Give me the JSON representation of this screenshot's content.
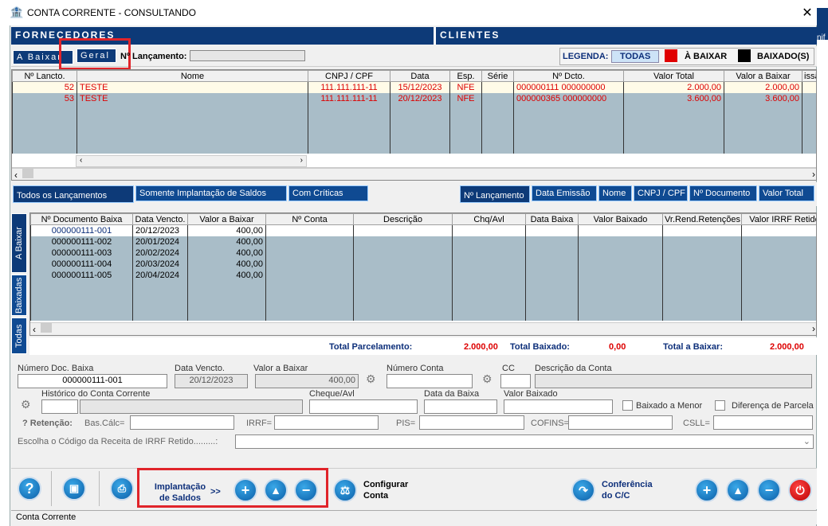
{
  "window": {
    "title": "CONTA CORRENTE  -  CONSULTANDO",
    "close": "✕",
    "right_text": "nif"
  },
  "tabs": {
    "fornecedores": "FORNECEDORES",
    "clientes": "CLIENTES"
  },
  "toolbar": {
    "a_baixar": "A Baixar",
    "geral": "Geral",
    "n_lancamento": "Nº Lançamento:",
    "legenda": "LEGENDA:",
    "todas": "TODAS",
    "a_baixar_leg": "À BAIXAR",
    "baixados": "BAIXADO(S)",
    "red": "#e00000",
    "black": "#000000"
  },
  "grid1": {
    "headers": [
      "Nº Lancto.",
      "Nome",
      "CNPJ / CPF",
      "Data",
      "Esp.",
      "Série",
      "Nº Dcto.",
      "Valor Total",
      "Valor a Baixar",
      "issão"
    ],
    "rows": [
      [
        "52",
        "TESTE",
        "111.111.111-11",
        "15/12/2023",
        "NFE",
        "",
        "000000111     000000000",
        "2.000,00",
        "2.000,00"
      ],
      [
        "53",
        "TESTE",
        "111.111.111-11",
        "20/12/2023",
        "NFE",
        "",
        "000000365     000000000",
        "3.600,00",
        "3.600,00"
      ]
    ]
  },
  "filters": {
    "todos": "Todos os Lançamentos",
    "somente": "Somente Implantação de Saldos",
    "com_criticas": "Com Críticas"
  },
  "sort": {
    "lancamento": "Nº Lançamento",
    "data_emissao": "Data Emissão",
    "nome": "Nome",
    "cnpj": "CNPJ / CPF",
    "documento": "Nº Documento",
    "valor_total": "Valor Total"
  },
  "vtabs": {
    "a_baixar": "A Baixar",
    "baixadas": "Baixadas",
    "todas": "Todas"
  },
  "grid2": {
    "headers": [
      "Nº Documento Baixa",
      "Data Vencto.",
      "Valor a Baixar",
      "Nº Conta",
      "Descrição",
      "Chq/Avl",
      "Data Baixa",
      "Valor Baixado",
      "Vr.Rend.Retenções",
      "Valor IRRF Retido"
    ],
    "rows": [
      [
        "000000111-001",
        "20/12/2023",
        "400,00"
      ],
      [
        "000000111-002",
        "20/01/2024",
        "400,00"
      ],
      [
        "000000111-003",
        "20/02/2024",
        "400,00"
      ],
      [
        "000000111-004",
        "20/03/2024",
        "400,00"
      ],
      [
        "000000111-005",
        "20/04/2024",
        "400,00"
      ]
    ]
  },
  "totals": {
    "parcelamento_label": "Total Parcelamento:",
    "parcelamento": "2.000,00",
    "baixado_label": "Total Baixado:",
    "baixado": "0,00",
    "a_baixar_label": "Total a Baixar:",
    "a_baixar": "2.000,00"
  },
  "form": {
    "numero_doc_label": "Número Doc. Baixa",
    "numero_doc": "000000111-001",
    "data_vencto_label": "Data Vencto.",
    "data_vencto": "20/12/2023",
    "valor_baixar_label": "Valor a Baixar",
    "valor_baixar": "400,00",
    "numero_conta_label": "Número Conta",
    "cc_label": "CC",
    "descricao_conta_label": "Descrição da Conta",
    "historico_label": "Histórico do Conta Corrente",
    "cheque_label": "Cheque/Avl",
    "data_baixa_label": "Data da Baixa",
    "valor_baixado_label": "Valor Baixado",
    "baixado_menor": "Baixado a Menor",
    "diferenca": "Diferença de Parcela",
    "retencao": "? Retenção:",
    "bas_calc": "Bas.Cálc=",
    "irrf": "IRRF=",
    "pis": "PIS=",
    "cofins": "COFINS=",
    "csll": "CSLL=",
    "escolha": "Escolha o Código da Receita de IRRF Retido.........:"
  },
  "bottom": {
    "implantacao": "Implantação de Saldos",
    "arrows": ">>",
    "configurar": "Configurar Conta",
    "conferencia": "Conferência do C/C"
  },
  "status": "Conta Corrente"
}
